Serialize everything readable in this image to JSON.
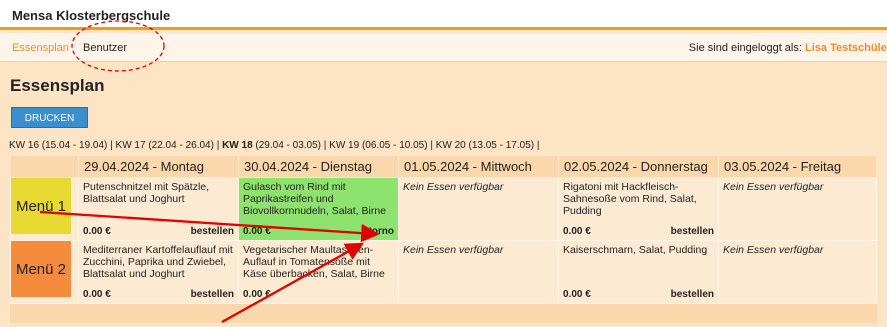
{
  "app_title": "Mensa Klosterbergschule",
  "nav": {
    "items": [
      "Essensplan",
      "Benutzer"
    ],
    "login_prefix": "Sie sind eingeloggt als:",
    "user": "Lisa Testschüler"
  },
  "page_title": "Essensplan",
  "print_label": "DRUCKEN",
  "weeks": {
    "before": "KW 16 (15.04 - 19.04) | KW 17 (22.04 - 26.04) | ",
    "current": "KW 18",
    "after": " (29.04 - 03.05) | KW 19 (06.05 - 10.05) | KW 20 (13.05 - 17.05) |"
  },
  "days": [
    "29.04.2024 - Montag",
    "30.04.2024 - Dienstag",
    "01.05.2024 - Mittwoch",
    "02.05.2024 - Donnerstag",
    "03.05.2024 - Freitag"
  ],
  "menus": [
    {
      "label": "Menü 1",
      "cells": [
        {
          "dish": "Putenschnitzel mit Spätzle, Blattsalat und Joghurt",
          "price": "0.00 €",
          "action": "bestellen"
        },
        {
          "dish": "Gulasch vom Rind mit Paprikastreifen und Biovollkornnudeln, Salat, Birne",
          "price": "0.00 €",
          "action": "storno"
        },
        {
          "dish": "Kein Essen verfügbar",
          "price": "",
          "action": ""
        },
        {
          "dish": "Rigatoni mit Hackfleisch-Sahnesoße vom Rind, Salat, Pudding",
          "price": "0.00 €",
          "action": "bestellen"
        },
        {
          "dish": "Kein Essen verfügbar",
          "price": "",
          "action": ""
        }
      ]
    },
    {
      "label": "Menü 2",
      "cells": [
        {
          "dish": "Mediterraner Kartoffelauflauf mit Zucchini, Paprika und Zwiebel, Blattsalat und Joghurt",
          "price": "0.00 €",
          "action": "bestellen"
        },
        {
          "dish": "Vegetarischer Maultaschen-Auflauf in Tomatensoße mit Käse überbacken, Salat, Birne",
          "price": "0.00 €",
          "action": ""
        },
        {
          "dish": "Kein Essen verfügbar",
          "price": "",
          "action": ""
        },
        {
          "dish": "Kaiserschmarn, Salat, Pudding",
          "price": "0.00 €",
          "action": "bestellen"
        },
        {
          "dish": "Kein Essen verfügbar",
          "price": "",
          "action": ""
        }
      ]
    }
  ],
  "colors": {
    "accent": "#e8902a",
    "selected": "#8ee26e",
    "menu1": "#e8da32",
    "menu2": "#f58b3c",
    "button": "#3a8fd1",
    "annotation": "#e00000"
  }
}
